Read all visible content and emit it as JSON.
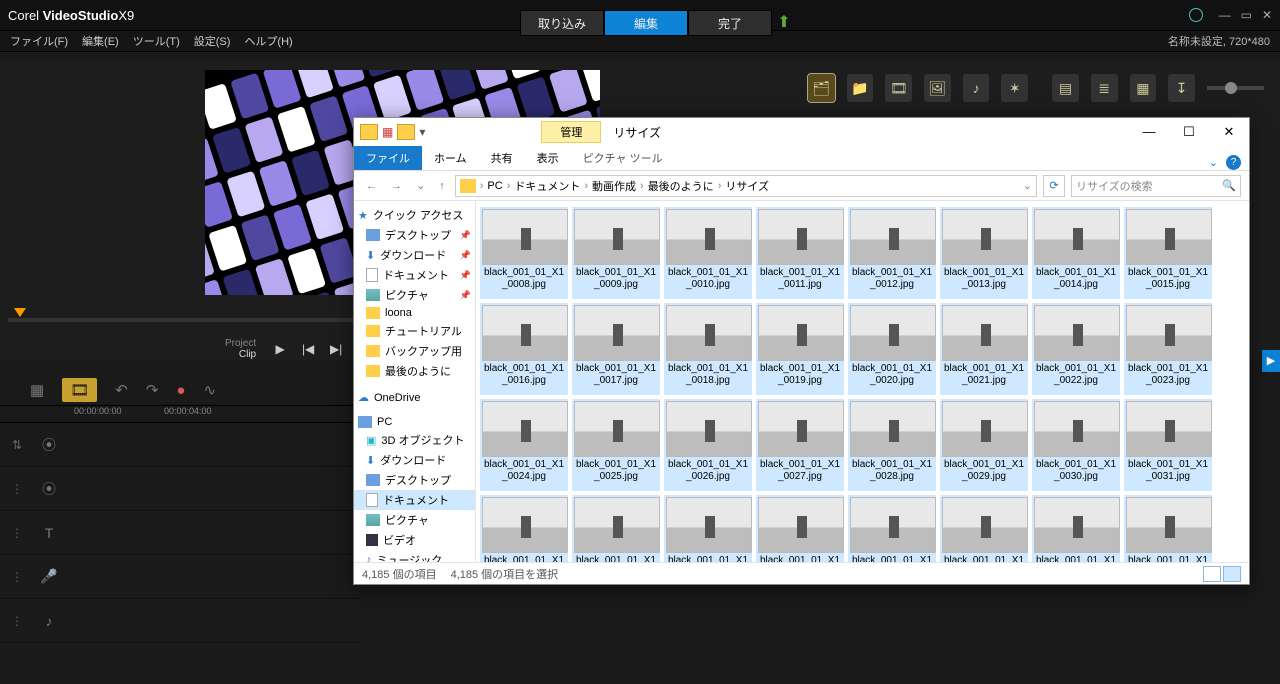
{
  "app": {
    "brand_a": "Corel",
    "brand_b": "VideoStudio",
    "brand_c": "X9"
  },
  "maintabs": {
    "capture": "取り込み",
    "edit": "編集",
    "share": "完了"
  },
  "menu": {
    "file": "ファイル(F)",
    "edit": "編集(E)",
    "tools": "ツール(T)",
    "settings": "設定(S)",
    "help": "ヘルプ(H)",
    "project": "名称未設定, 720*480"
  },
  "play": {
    "mode_a": "Project",
    "mode_b": "Clip"
  },
  "ruler": {
    "t0": "00:00:00:00",
    "t1": "00:00:04:00"
  },
  "explorer": {
    "context_tab": "管理",
    "title": "リサイズ",
    "ribbon": {
      "file": "ファイル",
      "home": "ホーム",
      "share": "共有",
      "view": "表示",
      "ctx": "ピクチャ ツール"
    },
    "crumbs": [
      "PC",
      "ドキュメント",
      "動画作成",
      "最後のように",
      "リサイズ"
    ],
    "search_placeholder": "リサイズの検索",
    "tree": {
      "quick": "クイック アクセス",
      "desktop": "デスクトップ",
      "downloads": "ダウンロード",
      "documents": "ドキュメント",
      "pictures": "ピクチャ",
      "loona": "loona",
      "tutorial": "チュートリアル",
      "backup": "バックアップ用",
      "last": "最後のように",
      "onedrive": "OneDrive",
      "pc": "PC",
      "obj3d": "3D オブジェクト",
      "downloads2": "ダウンロード",
      "desktop2": "デスクトップ",
      "documents2": "ドキュメント",
      "pictures2": "ピクチャ",
      "videos": "ビデオ",
      "music": "ミュージック"
    },
    "file_prefix": "black_001_01_X1_",
    "file_start": 8,
    "file_rows": 4,
    "status_count": "4,185 個の項目",
    "status_sel": "4,185 個の項目を選択"
  }
}
